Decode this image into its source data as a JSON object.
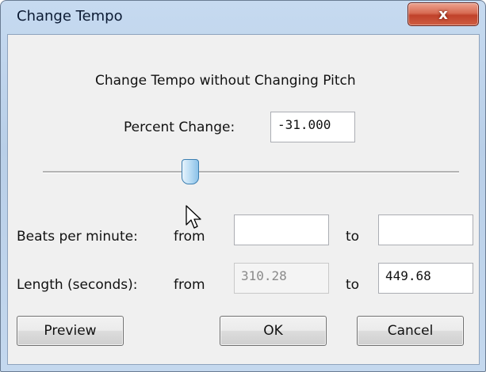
{
  "window": {
    "title": "Change Tempo",
    "close_glyph": "x"
  },
  "dialog": {
    "heading": "Change Tempo without Changing Pitch",
    "percent_label": "Percent Change:",
    "percent_value": "-31.000",
    "slider": {
      "value": -31.0
    },
    "bpm": {
      "label": "Beats per minute:",
      "from_label": "from",
      "from_value": "",
      "to_label": "to",
      "to_value": ""
    },
    "length": {
      "label": "Length (seconds):",
      "from_label": "from",
      "from_value": "310.28",
      "to_label": "to",
      "to_value": "449.68"
    }
  },
  "buttons": {
    "preview": "Preview",
    "ok": "OK",
    "cancel": "Cancel"
  },
  "icons": [
    "close-icon",
    "mouse-pointer-icon"
  ]
}
